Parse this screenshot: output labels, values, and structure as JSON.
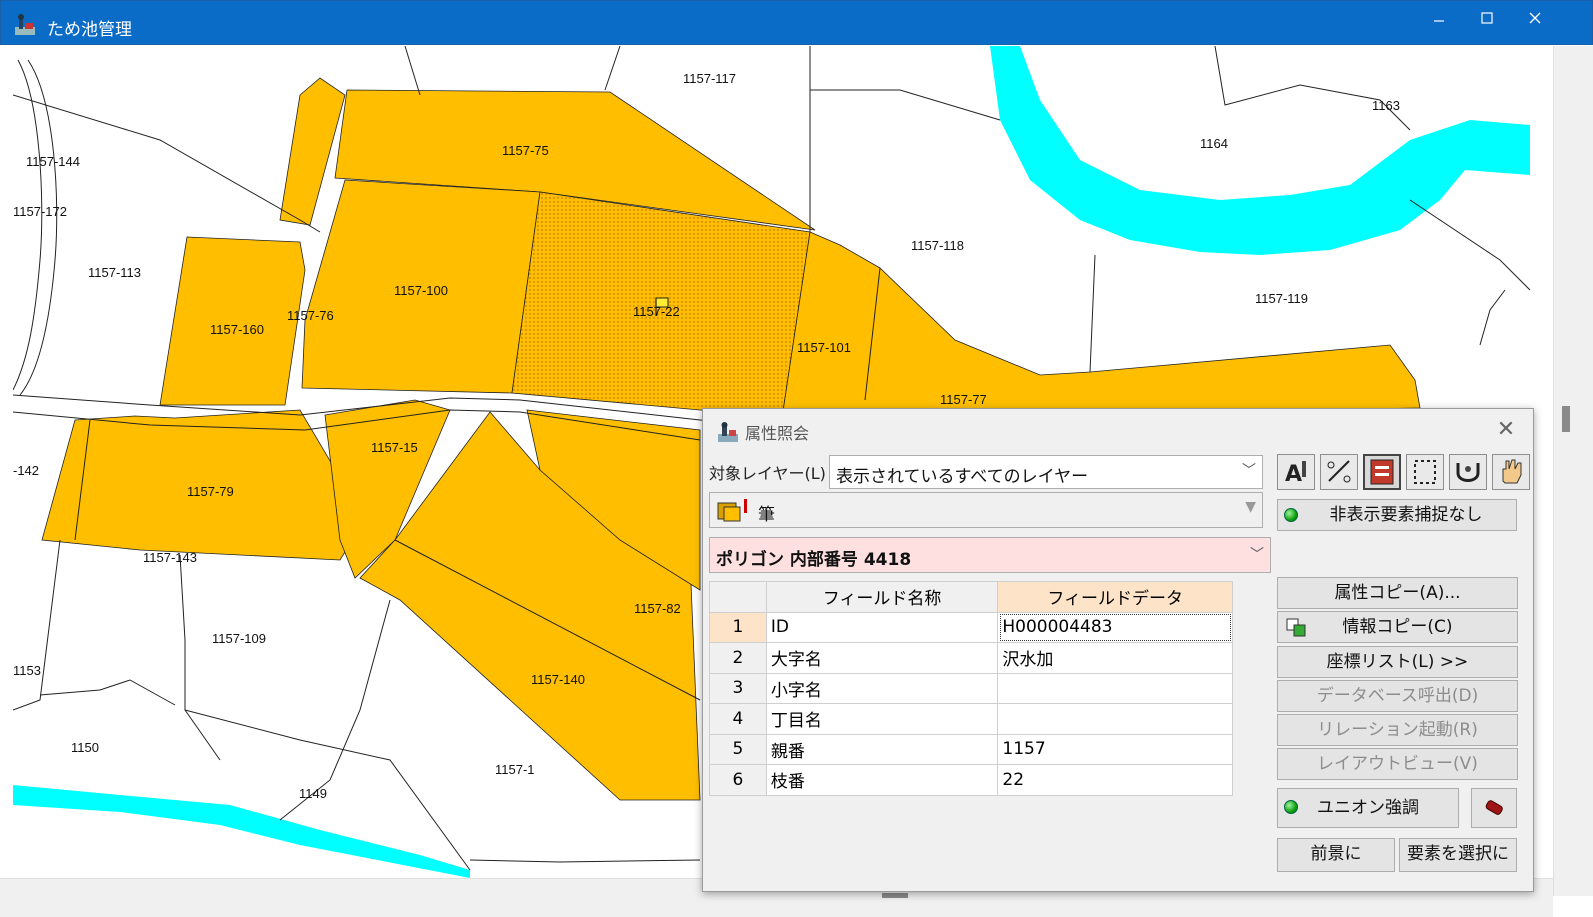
{
  "window": {
    "title": "ため池管理"
  },
  "map": {
    "parcel_labels": [
      "1157-117",
      "1157-144",
      "1157-172",
      "1157-75",
      "1157-113",
      "1157-160",
      "1157-76",
      "1157-100",
      "1157-22",
      "1157-101",
      "1157-118",
      "1163",
      "1164",
      "1157-119",
      "1157-77",
      "1157-15",
      "-142",
      "1157-79",
      "1157-143",
      "1157-82",
      "1157-109",
      "1153",
      "1157-140",
      "1150",
      "1157-1",
      "1149"
    ],
    "colors": {
      "parcel_fill": "#ffbf00",
      "water": "#00ffff",
      "selected_hatch": "#f4d0d8"
    }
  },
  "dialog": {
    "title": "属性照会",
    "layer_label": "対象レイヤー(L)",
    "layer_value": "表示されているすべてのレイヤー",
    "feature_layer": "筆",
    "element_value": "ポリゴン 内部番号 4418",
    "hidden_capture": "非表示要素捕捉なし",
    "grid": {
      "headers": [
        "フィールド名称",
        "フィールドデータ"
      ],
      "rows": [
        {
          "num": "1",
          "name": "ID",
          "data": "H000004483"
        },
        {
          "num": "2",
          "name": "大字名",
          "data": "沢水加"
        },
        {
          "num": "3",
          "name": "小字名",
          "data": ""
        },
        {
          "num": "4",
          "name": "丁目名",
          "data": ""
        },
        {
          "num": "5",
          "name": "親番",
          "data": "1157"
        },
        {
          "num": "6",
          "name": "枝番",
          "data": "22"
        }
      ]
    },
    "buttons": {
      "attr_copy": "属性コピー(A)...",
      "info_copy": "情報コピー(C)",
      "coord_list": "座標リスト(L) >>",
      "db_call": "データベース呼出(D)",
      "relation": "リレーション起動(R)",
      "layout_view": "レイアウトビュー(V)",
      "union": "ユニオン強調",
      "foreground": "前景に",
      "select_element": "要素を選択に"
    }
  }
}
